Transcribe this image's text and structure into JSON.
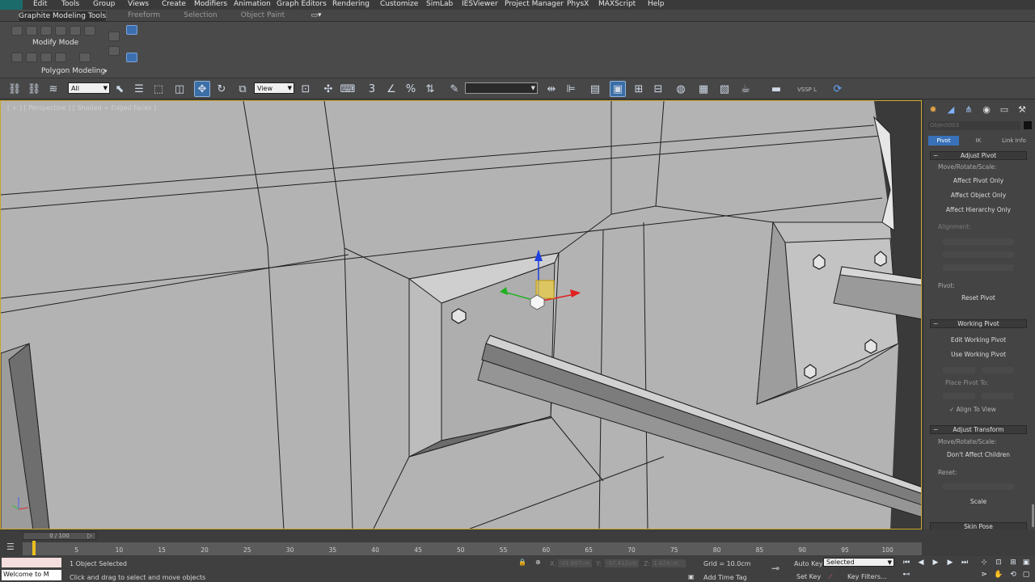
{
  "menubar": {
    "items": [
      "Edit",
      "Tools",
      "Group",
      "Views",
      "Create",
      "Modifiers",
      "Animation",
      "Graph Editors",
      "Rendering",
      "Customize",
      "SimLab",
      "IESViewer",
      "Project Manager",
      "PhysX",
      "MAXScript",
      "Help"
    ]
  },
  "ribbon": {
    "tabs": [
      "Graphite Modeling Tools",
      "Freeform",
      "Selection",
      "Object Paint"
    ],
    "modify_mode": "Modify Mode",
    "polygon_modeling": "Polygon Modeling"
  },
  "toolbar": {
    "selection_filter": "All",
    "reference_coord": "View",
    "named_selection": "",
    "vssp_label": "VSSP L"
  },
  "viewport": {
    "label": "[ + ] [ Perspective ] [ Shaded + Edged Faces ]"
  },
  "command_panel": {
    "object_name": "Object003",
    "subtabs": [
      "Pivot",
      "IK",
      "Link Info"
    ],
    "adjust_pivot": {
      "title": "Adjust Pivot",
      "move_rotate_scale": "Move/Rotate/Scale:",
      "affect_pivot_only": "Affect Pivot Only",
      "affect_object_only": "Affect Object Only",
      "affect_hierarchy_only": "Affect Hierarchy Only",
      "alignment": "Alignment:",
      "pivot": "Pivot:",
      "reset_pivot": "Reset Pivot"
    },
    "working_pivot": {
      "title": "Working Pivot",
      "edit_working_pivot": "Edit Working Pivot",
      "use_working_pivot": "Use Working Pivot",
      "place_pivot_to": "Place Pivot To:",
      "align_to_view": "Align To View"
    },
    "adjust_transform": {
      "title": "Adjust Transform",
      "move_rotate_scale": "Move/Rotate/Scale:",
      "dont_affect_children": "Don't Affect Children",
      "reset": "Reset:",
      "scale": "Scale"
    },
    "skin_pose": {
      "title": "Skin Pose"
    }
  },
  "timeline": {
    "frame_counter": "0 / 100",
    "ticks": [
      "5",
      "10",
      "15",
      "20",
      "25",
      "30",
      "35",
      "40",
      "45",
      "50",
      "55",
      "60",
      "65",
      "70",
      "75",
      "80",
      "85",
      "90",
      "95",
      "100"
    ]
  },
  "statusbar": {
    "listener": "Welcome to M",
    "selection_status": "1 Object Selected",
    "prompt": "Click and drag to select and move objects",
    "x_value": "-31.907cm",
    "y_value": "-37.412cm",
    "z_value": "1.424cm",
    "grid": "Grid = 10.0cm",
    "add_time_tag": "Add Time Tag",
    "auto_key": "Auto Key",
    "auto_key_mode": "Selected",
    "set_key": "Set Key",
    "key_filters": "Key Filters..."
  }
}
